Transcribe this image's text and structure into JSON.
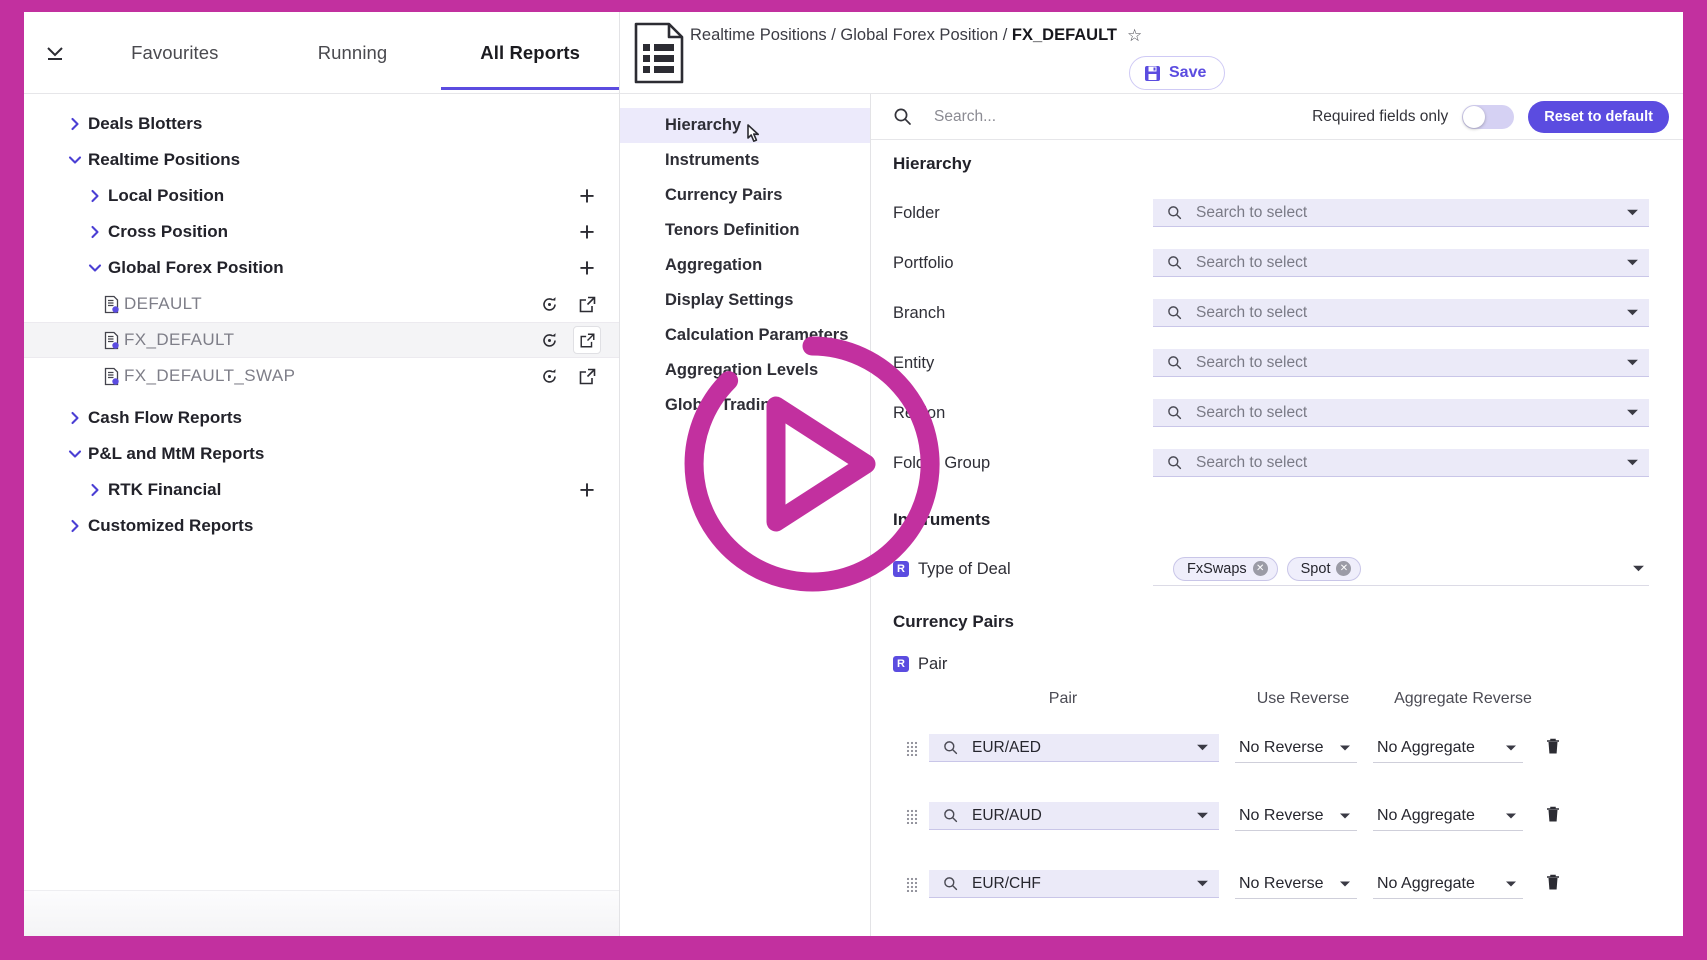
{
  "theme": {
    "magenta": "#c2309f",
    "accent": "#5b4ce0",
    "field_bg": "#ebeaf8",
    "active_nav_bg": "#eceafb"
  },
  "sidebar": {
    "collapse_icon": "chevron-down-bar-icon",
    "tabs": [
      {
        "label": "Favourites",
        "active": false
      },
      {
        "label": "Running",
        "active": false
      },
      {
        "label": "All Reports",
        "active": true
      }
    ],
    "tree": [
      {
        "label": "Deals Blotters",
        "indent": 0,
        "caret": "right",
        "type": "group",
        "actions": []
      },
      {
        "label": "Realtime Positions",
        "indent": 0,
        "caret": "down",
        "type": "group",
        "actions": []
      },
      {
        "label": "Local Position",
        "indent": 1,
        "caret": "right",
        "type": "group",
        "actions": [
          "plus"
        ]
      },
      {
        "label": "Cross Position",
        "indent": 1,
        "caret": "right",
        "type": "group",
        "actions": [
          "plus"
        ]
      },
      {
        "label": "Global Forex Position",
        "indent": 1,
        "caret": "down",
        "type": "group",
        "actions": [
          "plus"
        ]
      },
      {
        "label": "DEFAULT",
        "indent": 2,
        "caret": "none",
        "type": "report",
        "actions": [
          "refresh",
          "open"
        ]
      },
      {
        "label": "FX_DEFAULT",
        "indent": 2,
        "caret": "none",
        "type": "report",
        "selected": true,
        "actions": [
          "refresh",
          "open-boxed"
        ]
      },
      {
        "label": "FX_DEFAULT_SWAP",
        "indent": 2,
        "caret": "none",
        "type": "report",
        "actions": [
          "refresh",
          "open"
        ]
      },
      {
        "label": "Cash Flow Reports",
        "indent": 0,
        "caret": "right",
        "type": "group",
        "actions": []
      },
      {
        "label": "P&L and MtM Reports",
        "indent": 0,
        "caret": "down",
        "type": "group",
        "actions": []
      },
      {
        "label": "RTK Financial",
        "indent": 1,
        "caret": "right",
        "type": "group",
        "actions": [
          "plus"
        ]
      },
      {
        "label": "Customized Reports",
        "indent": 0,
        "caret": "right",
        "type": "group",
        "actions": []
      }
    ]
  },
  "header": {
    "document_icon": "report-document-icon",
    "breadcrumb_prefix": "Realtime Positions / Global Forex Position / ",
    "breadcrumb_current": "FX_DEFAULT",
    "favourite_icon": "star-outline-icon",
    "save_label": "Save",
    "save_icon": "floppy-disk-icon"
  },
  "nav": {
    "items": [
      {
        "label": "Hierarchy",
        "active": true
      },
      {
        "label": "Instruments",
        "active": false
      },
      {
        "label": "Currency Pairs",
        "active": false
      },
      {
        "label": "Tenors Definition",
        "active": false
      },
      {
        "label": "Aggregation",
        "active": false
      },
      {
        "label": "Display Settings",
        "active": false
      },
      {
        "label": "Calculation Parameters",
        "active": false
      },
      {
        "label": "Aggregation Levels",
        "active": false
      },
      {
        "label": "Global Trading",
        "active": false
      }
    ]
  },
  "panel": {
    "search": {
      "placeholder": "Search...",
      "value": "",
      "icon": "search-icon"
    },
    "required_toggle_label": "Required fields only",
    "required_toggle_on": false,
    "reset_label": "Reset to default",
    "sections": {
      "hierarchy": {
        "title": "Hierarchy",
        "fields": [
          {
            "label": "Folder",
            "placeholder": "Search to select"
          },
          {
            "label": "Portfolio",
            "placeholder": "Search to select"
          },
          {
            "label": "Branch",
            "placeholder": "Search to select"
          },
          {
            "label": "Entity",
            "placeholder": "Search to select"
          },
          {
            "label": "Region",
            "placeholder": "Search to select"
          },
          {
            "label": "Folder Group",
            "placeholder": "Search to select"
          }
        ]
      },
      "instruments": {
        "title": "Instruments",
        "field_label": "Type of Deal",
        "required_badge": "R",
        "chips": [
          {
            "label": "FxSwaps"
          },
          {
            "label": "Spot"
          }
        ]
      },
      "currency_pairs": {
        "title": "Currency Pairs",
        "field_label": "Pair",
        "required_badge": "R",
        "columns": [
          "Pair",
          "Use Reverse",
          "Aggregate Reverse"
        ],
        "rows": [
          {
            "pair": "EUR/AED",
            "use_reverse": "No Reverse",
            "aggregate_reverse": "No Aggregate"
          },
          {
            "pair": "EUR/AUD",
            "use_reverse": "No Reverse",
            "aggregate_reverse": "No Aggregate"
          },
          {
            "pair": "EUR/CHF",
            "use_reverse": "No Reverse",
            "aggregate_reverse": "No Aggregate"
          }
        ]
      }
    }
  },
  "overlay": {
    "play_icon": "play-circle-icon"
  }
}
